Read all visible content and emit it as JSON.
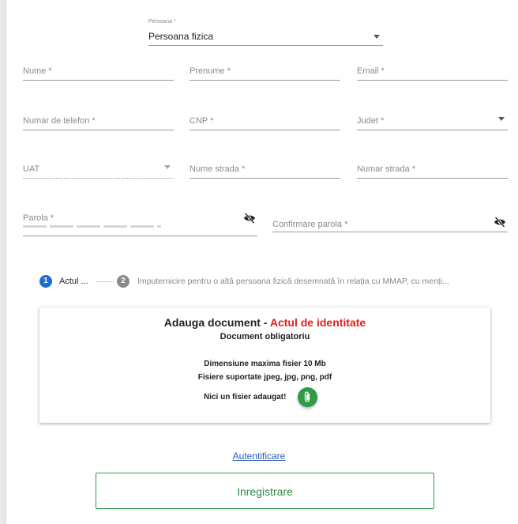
{
  "form": {
    "persoana": {
      "label": "Persoana *",
      "value": "Persoana fizica"
    },
    "nume": {
      "label": "Nume *"
    },
    "prenume": {
      "label": "Prenume *"
    },
    "email": {
      "label": "Email *"
    },
    "telefon": {
      "label": "Numar de telefon *"
    },
    "cnp": {
      "label": "CNP *"
    },
    "judet": {
      "label": "Judet *"
    },
    "uat": {
      "label": "UAT"
    },
    "strada": {
      "label": "Nume strada *"
    },
    "nr_strada": {
      "label": "Numar strada *"
    },
    "parola": {
      "label": "Parola *"
    },
    "confirmare": {
      "label": "Confirmare parola *"
    }
  },
  "stepper": {
    "steps": [
      {
        "number": "1",
        "label": "Actul ..."
      },
      {
        "number": "2",
        "label": "Imputernicire pentru o altă persoana fizică desemnată în relația cu MMAP, cu menți..."
      }
    ]
  },
  "upload": {
    "title_prefix": "Adauga document - ",
    "title_doc": "Actul de identitate",
    "mandatory": "Document obligatoriu",
    "max_size": "Dimensiune maxima fisier 10 Mb",
    "types": "Fisiere suportate jpeg, jpg, png, pdf",
    "none": "Nici un fisier adaugat!"
  },
  "actions": {
    "login_link": "Autentificare",
    "register": "Inregistrare"
  },
  "icons": {
    "eye_off": "eye-off-icon",
    "attach": "paperclip-icon",
    "dropdown": "chevron-down-icon"
  },
  "colors": {
    "accent_blue": "#1e6fd0",
    "step_inactive": "#8a8a8a",
    "green": "#2e9b46",
    "red": "#e51c1c",
    "link": "#2a5fb8"
  }
}
